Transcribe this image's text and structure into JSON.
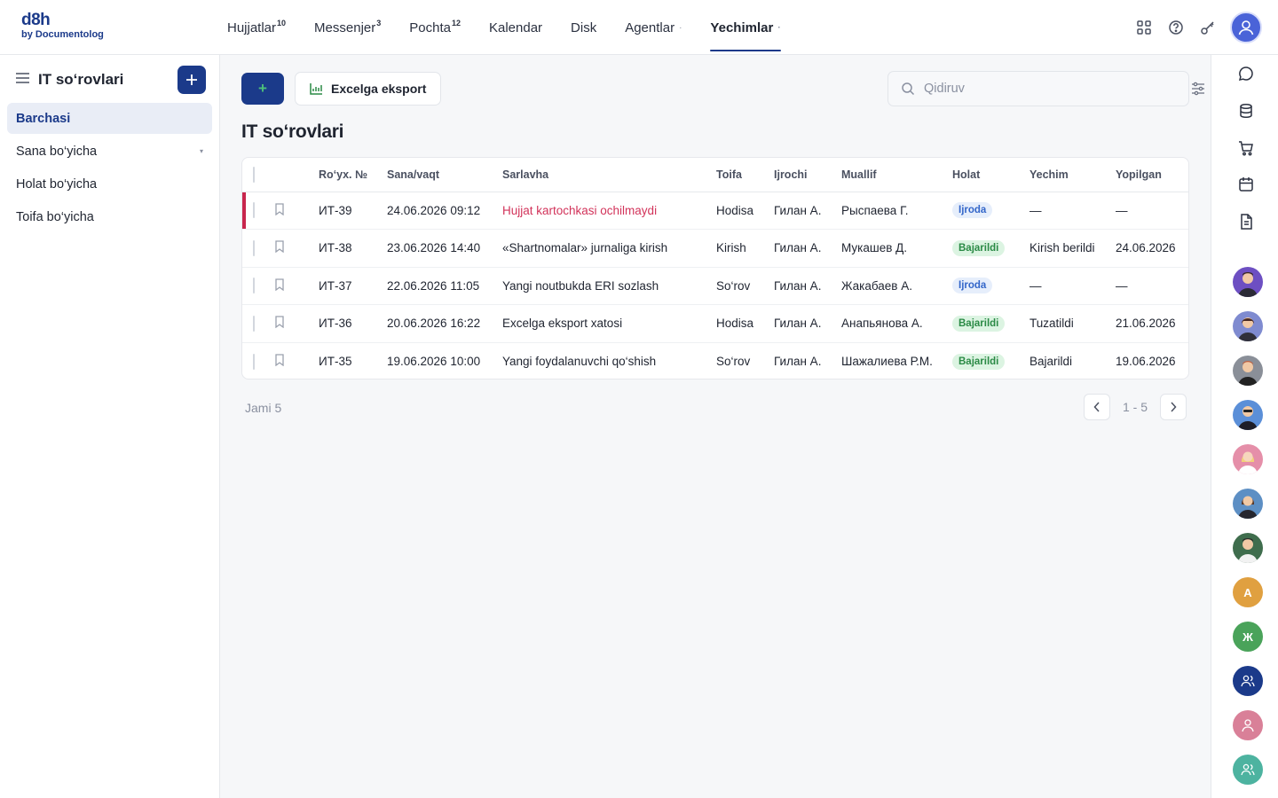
{
  "logo": {
    "main": "d8h",
    "sub": "by Documentolog"
  },
  "nav": [
    {
      "label": "Hujjatlar",
      "badge": "10"
    },
    {
      "label": "Messenjer",
      "badge": "3"
    },
    {
      "label": "Pochta",
      "badge": "12"
    },
    {
      "label": "Kalendar",
      "badge": ""
    },
    {
      "label": "Disk",
      "badge": ""
    },
    {
      "label": "Agentlar",
      "dot": "·"
    },
    {
      "label": "Yechimlar",
      "dot": "·"
    }
  ],
  "sidebar": {
    "title": "IT so‘rovlari",
    "items": [
      {
        "label": "Barchasi"
      },
      {
        "label": "Sana bo‘yicha",
        "caret": "▾"
      },
      {
        "label": "Holat bo‘yicha"
      },
      {
        "label": "Toifa bo‘yicha"
      }
    ]
  },
  "toolbar": {
    "export_label": "Excelga eksport",
    "add_label": "+"
  },
  "search": {
    "placeholder": "Qidiruv"
  },
  "page_title": "IT so‘rovlari",
  "table": {
    "headers": [
      "Ro‘yx. №",
      "Sana/vaqt",
      "Sarlavha",
      "Toifa",
      "Ijrochi",
      "Muallif",
      "Holat",
      "Yechim",
      "Yopilgan"
    ],
    "rows": [
      [
        "ИТ-39",
        "24.06.2026 09:12",
        "Hujjat kartochkasi ochilmaydi",
        "Hodisa",
        "Гилан А.",
        "Рыспаева Г.",
        "Ijroda",
        "—",
        "—"
      ],
      [
        "ИТ-38",
        "23.06.2026 14:40",
        "«Shartnomalar» jurnaliga kirish",
        "Kirish",
        "Гилан А.",
        "Мукашев Д.",
        "Bajarildi",
        "Kirish berildi",
        "24.06.2026"
      ],
      [
        "ИТ-37",
        "22.06.2026 11:05",
        "Yangi noutbukda ERI sozlash",
        "So‘rov",
        "Гилан А.",
        "Жакабаев А.",
        "Ijroda",
        "—",
        "—"
      ],
      [
        "ИТ-36",
        "20.06.2026 16:22",
        "Excelga eksport xatosi",
        "Hodisa",
        "Гилан А.",
        "Анапьянова А.",
        "Bajarildi",
        "Tuzatildi",
        "21.06.2026"
      ],
      [
        "ИТ-35",
        "19.06.2026 10:00",
        "Yangi foydalanuvchi qo‘shish",
        "So‘rov",
        "Гилан А.",
        "Шажалиева Р.М.",
        "Bajarildi",
        "Bajarildi",
        "19.06.2026"
      ]
    ]
  },
  "footer": {
    "total": "Jami 5",
    "range": "1 - 5"
  },
  "rail": {
    "icons": [
      "chat-icon",
      "database-icon",
      "cart-icon",
      "calendar-icon",
      "document-icon"
    ],
    "avatars": [
      {
        "initial": "",
        "color": "#6d4fc2"
      },
      {
        "initial": "",
        "color": "#7f8bd0"
      },
      {
        "initial": "",
        "color": "#8a8f98"
      },
      {
        "initial": "",
        "color": "#5b8fd8"
      },
      {
        "initial": "",
        "color": "#e58fa9"
      },
      {
        "initial": "",
        "color": "#5d8fc4"
      },
      {
        "initial": "",
        "color": "#3f6d4d"
      },
      {
        "initial": "А",
        "color": "#e0a040"
      },
      {
        "initial": "Ж",
        "color": "#4aa35a"
      },
      {
        "initial": "",
        "color": "#1b3a8a"
      },
      {
        "initial": "",
        "color": "#d98098"
      },
      {
        "initial": "",
        "color": "#4db3a0"
      }
    ]
  },
  "colors": {
    "accent": "#1b3a8a",
    "danger": "#c8264d",
    "success_badge": "#dcf4e2",
    "info_badge": "#e6eefb"
  }
}
